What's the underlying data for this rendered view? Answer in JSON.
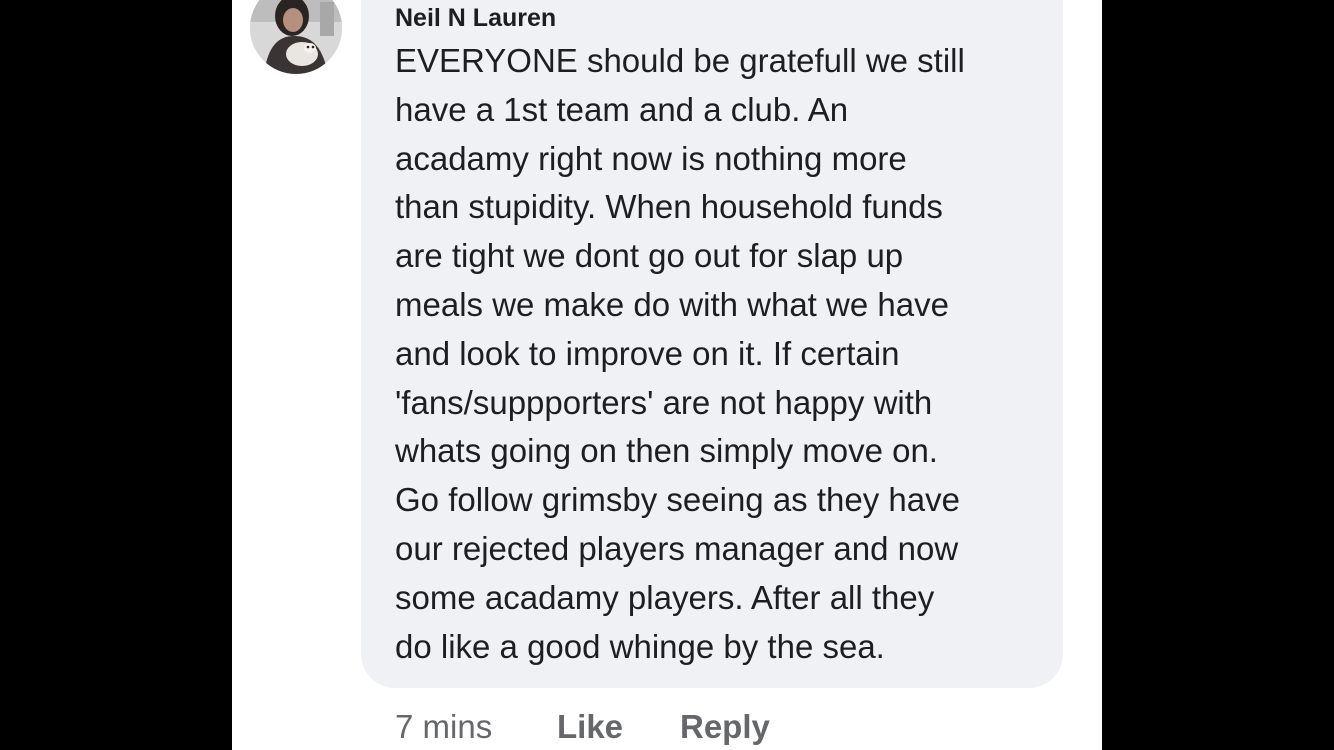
{
  "comment": {
    "author": "Neil N Lauren",
    "lines": [
      "EVERYONE should be gratefull we still",
      "have a 1st team and a club. An",
      "acadamy right now is nothing more",
      "than stupidity. When household funds",
      "are tight we dont go out for slap up",
      "meals we make do with what we have",
      "and look to improve on it. If certain",
      "'fans/suppporters' are not happy with",
      "whats going on then simply move on.",
      "Go follow grimsby seeing as they have",
      "our rejected players manager and now",
      "some acadamy players. After all they",
      "do like a good whinge by the sea."
    ],
    "timestamp": "7 mins",
    "like_label": "Like",
    "reply_label": "Reply"
  },
  "colors": {
    "bubble_bg": "#f0f1f5",
    "text": "#1c1e21",
    "meta_text": "#65676b",
    "page_bg": "#ffffff",
    "letterbox": "#000000"
  },
  "icons": {
    "avatar": "profile-photo"
  }
}
